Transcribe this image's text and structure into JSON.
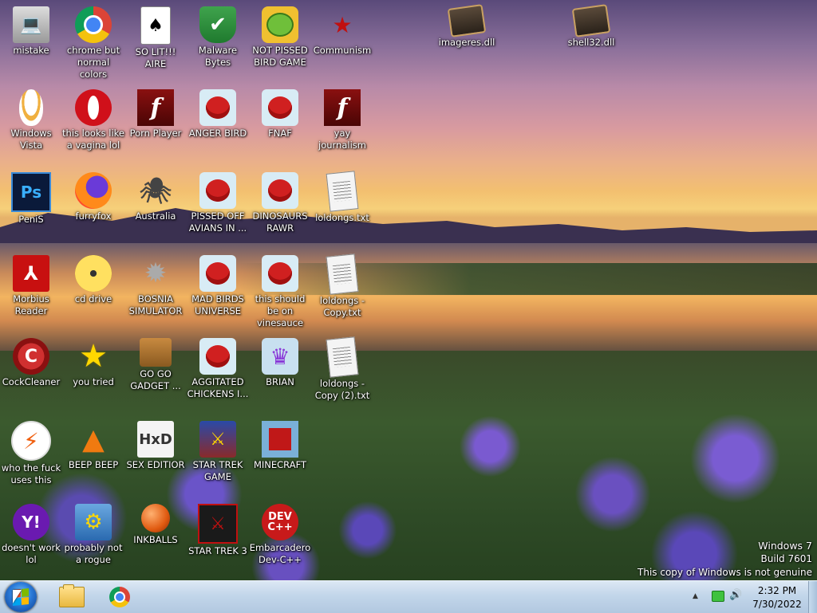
{
  "desktop": {
    "icons": [
      {
        "id": "mistake",
        "label": "mistake",
        "glyph": "💻"
      },
      {
        "id": "chrome",
        "label": "chrome but normal colors",
        "glyph": ""
      },
      {
        "id": "solitaire",
        "label": "SO LIT!!! AIRE",
        "glyph": "♠"
      },
      {
        "id": "malware",
        "label": "Malware Bytes",
        "glyph": "✔"
      },
      {
        "id": "pig",
        "label": "NOT PISSED BIRD GAME",
        "glyph": ""
      },
      {
        "id": "communism",
        "label": "Communism",
        "glyph": "★"
      },
      {
        "id": "imageres",
        "label": "imageres.dll",
        "glyph": ""
      },
      {
        "id": "shell32",
        "label": "shell32.dll",
        "glyph": ""
      },
      {
        "id": "vista",
        "label": "Windows Vista",
        "glyph": ""
      },
      {
        "id": "opera",
        "label": "this looks like a vagina lol",
        "glyph": ""
      },
      {
        "id": "flash1",
        "label": "Porn Player",
        "glyph": "f"
      },
      {
        "id": "anger",
        "label": "ANGER BIRD",
        "glyph": ""
      },
      {
        "id": "fnaf",
        "label": "FNAF",
        "glyph": ""
      },
      {
        "id": "flash2",
        "label": "yay journalism",
        "glyph": "f"
      },
      {
        "id": "ps",
        "label": "PeniS",
        "glyph": "Ps"
      },
      {
        "id": "furryfox",
        "label": "furryfox",
        "glyph": ""
      },
      {
        "id": "australia",
        "label": "Australia",
        "glyph": "🕷"
      },
      {
        "id": "avians",
        "label": "PISSED OFF AVIANS IN ...",
        "glyph": ""
      },
      {
        "id": "dinosaurs",
        "label": "DINOSAURS RAWR",
        "glyph": ""
      },
      {
        "id": "loldongs1",
        "label": "loldongs.txt",
        "glyph": ""
      },
      {
        "id": "morbius",
        "label": "Morbius Reader",
        "glyph": "⅄"
      },
      {
        "id": "cddrive",
        "label": "cd drive",
        "glyph": ""
      },
      {
        "id": "bosnia",
        "label": "BOSNIA SIMULATOR",
        "glyph": "✹"
      },
      {
        "id": "madbirds",
        "label": "MAD BIRDS UNIVERSE",
        "glyph": ""
      },
      {
        "id": "vinesauce",
        "label": "this should be on vinesauce",
        "glyph": ""
      },
      {
        "id": "loldongs2",
        "label": "loldongs - Copy.txt",
        "glyph": ""
      },
      {
        "id": "cockcleaner",
        "label": "CockCleaner",
        "glyph": "C"
      },
      {
        "id": "youtried",
        "label": "you tried",
        "glyph": "★"
      },
      {
        "id": "gogo",
        "label": "GO GO GADGET ...",
        "glyph": ""
      },
      {
        "id": "aggitated",
        "label": "AGGITATED CHICKENS I...",
        "glyph": ""
      },
      {
        "id": "brian",
        "label": "BRIAN",
        "glyph": "♛"
      },
      {
        "id": "loldongs3",
        "label": "loldongs - Copy (2).txt",
        "glyph": ""
      },
      {
        "id": "whothefuck",
        "label": "who the fuck uses this",
        "glyph": "⚡"
      },
      {
        "id": "beepbeep",
        "label": "BEEP BEEP",
        "glyph": "▲"
      },
      {
        "id": "sexeditior",
        "label": "SEX EDITIOR",
        "glyph": "HxD"
      },
      {
        "id": "startrekgame",
        "label": "STAR TREK GAME",
        "glyph": "⚔"
      },
      {
        "id": "minecraft",
        "label": "MINECRAFT",
        "glyph": ""
      },
      {
        "id": "doesntwork",
        "label": "doesn't work lol",
        "glyph": "Y!"
      },
      {
        "id": "rogue",
        "label": "probably not a rogue",
        "glyph": "⚙"
      },
      {
        "id": "inkballs",
        "label": "INKBALLS",
        "glyph": ""
      },
      {
        "id": "startrek3",
        "label": "STAR TREK 3",
        "glyph": "⚔"
      },
      {
        "id": "devcpp",
        "label": "Embarcadero Dev-C++",
        "glyph": "DEV C++"
      }
    ]
  },
  "watermark": {
    "line1": "Windows 7",
    "line2": "Build 7601",
    "line3": "This copy of Windows is not genuine"
  },
  "taskbar": {
    "clock_time": "2:32 PM",
    "clock_date": "7/30/2022",
    "tray_up_glyph": "▲",
    "tray_speaker_glyph": "🔊"
  },
  "colors": {
    "taskbar": "#c2d6ea",
    "win_red": "#f25022",
    "win_green": "#7fba00",
    "win_blue": "#00a4ef",
    "win_yellow": "#ffb900"
  }
}
